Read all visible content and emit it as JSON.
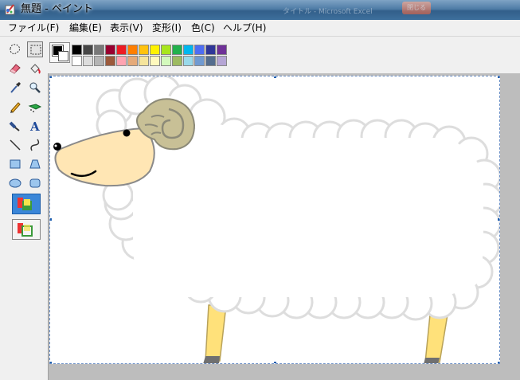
{
  "window": {
    "title": "無題 - ペイント",
    "background_task_title": "タイトル - Microsoft Excel",
    "background_task_button": "閉じる",
    "app_icon": "paint-app-icon"
  },
  "menu": {
    "items": [
      "ファイル(F)",
      "編集(E)",
      "表示(V)",
      "変形(I)",
      "色(C)",
      "ヘルプ(H)"
    ]
  },
  "tools": [
    {
      "name": "free-form-select-icon"
    },
    {
      "name": "rect-select-icon",
      "selected": true
    },
    {
      "name": "eraser-icon"
    },
    {
      "name": "fill-bucket-icon"
    },
    {
      "name": "color-picker-icon"
    },
    {
      "name": "magnifier-icon"
    },
    {
      "name": "pencil-icon"
    },
    {
      "name": "airbrush-icon"
    },
    {
      "name": "brush-icon"
    },
    {
      "name": "text-icon",
      "label": "A"
    },
    {
      "name": "line-icon"
    },
    {
      "name": "curve-icon"
    },
    {
      "name": "rectangle-icon"
    },
    {
      "name": "polygon-icon"
    },
    {
      "name": "ellipse-icon"
    },
    {
      "name": "rounded-rect-icon"
    }
  ],
  "tool_options": [
    {
      "name": "opaque-selection-option",
      "selected": true
    },
    {
      "name": "transparent-selection-option",
      "selected": false
    }
  ],
  "colors": {
    "foreground": "#000000",
    "background": "#ffffff",
    "palette_top": [
      "#000000",
      "#464646",
      "#787878",
      "#990030",
      "#ed1c24",
      "#ff7e00",
      "#ffc20e",
      "#fff200",
      "#a8e61d",
      "#22b14c",
      "#00b7ef",
      "#4d6df3",
      "#2f3699",
      "#6f3198"
    ],
    "palette_bottom": [
      "#ffffff",
      "#dcdcdc",
      "#b4b4b4",
      "#9c5a3c",
      "#ffa3b1",
      "#e5aa7a",
      "#f5e49c",
      "#fff9bd",
      "#d3f9bc",
      "#9dbb61",
      "#99d9ea",
      "#709ad1",
      "#546d8e",
      "#b5a5d5"
    ],
    "sheep_wool": "#ffffff",
    "sheep_outline": "#dddddd",
    "sheep_face": "#ffe6b4",
    "sheep_horn": "#c8c096",
    "sheep_legs": "#ffe17a",
    "hooves": "#707070",
    "selection_border": "#6a8ec4"
  },
  "canvas": {
    "drawing": "sheep-illustration"
  }
}
